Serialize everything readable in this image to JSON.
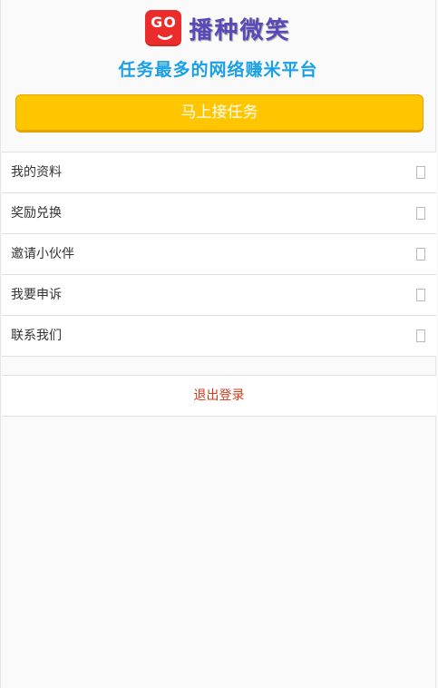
{
  "brand": {
    "logo_text": "GO",
    "name": "播种微笑"
  },
  "tagline": "任务最多的网络赚米平台",
  "cta": {
    "label": "马上接任务"
  },
  "menu": {
    "items": [
      {
        "label": "我的资料",
        "icon": "chevron-right-icon"
      },
      {
        "label": "奖励兑换",
        "icon": "chevron-right-icon"
      },
      {
        "label": "邀请小伙伴",
        "icon": "chevron-right-icon"
      },
      {
        "label": "我要申诉",
        "icon": "chevron-right-icon"
      },
      {
        "label": "联系我们",
        "icon": "chevron-right-icon"
      }
    ]
  },
  "logout": {
    "label": "退出登录"
  },
  "colors": {
    "accent_blue": "#1aa0e6",
    "cta_yellow": "#ffc600",
    "brand_purple": "#5848b8",
    "logo_red": "#ec2b2b",
    "logout_red": "#d23b1c"
  }
}
